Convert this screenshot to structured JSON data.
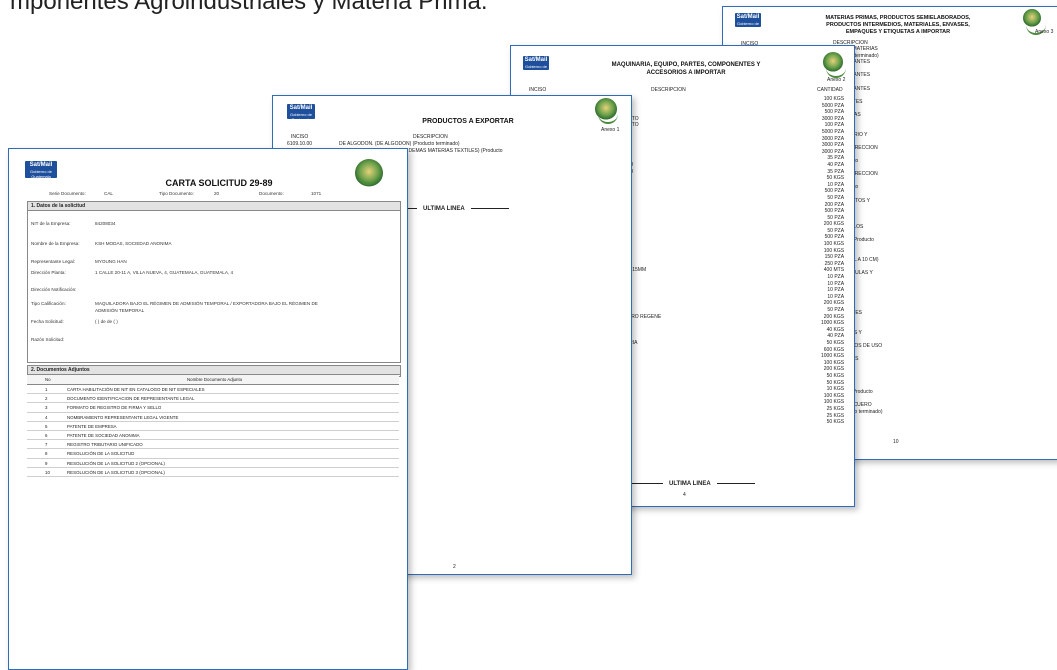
{
  "headline": "mponentes Agroindustriales y Materia Prima.",
  "doc_a3": {
    "title_lines": [
      "MATERIAS PRIMAS, PRODUCTOS SEMIELABORADOS,",
      "PRODUCTOS INTERMEDIOS, MATERIALES, ENVASES,",
      "EMPAQUES Y ETIQUETAS A IMPORTAR"
    ],
    "anexo": "Anexo 3",
    "col_inciso": "INCISO",
    "col_desc": "DESCRIPCION",
    "rows": [
      "ORIGEN VEGETAL O ANIMAL (INCLUIDOS LO, MATERIAS",
      "VEGETAL O ANIMAL (INCLUIDOS LO) (Producto terminado)",
      "PREPARACIONES A BASE DE ESTOS. (COLORANTES",
      "NES A BASE DE ESTOS) (Producto terminado)",
      "PREPARACIONES A BASE DE ESTOS. (COLORANTES",
      "ES A BASE DE ESTOS) (Producto terminado)",
      "PREPARACIONES A BASE DE ESTOS. (COLORANTES",
      "NES A BASE DE ESTOS) (Producto terminado)",
      "IS Y PREPARACIONES A BASE DE. (COLORANTES",
      "CIONES A BASE DE) (Producto terminado)",
      "MEZCLAS DE MATERIAS COLORAN. (LAS DEMAS",
      "MATERIAS COLORAN) (Producto terminado)",
      "roducto terminado)",
      "DRIOS, EN POLVO, GRANULOS. (FRITA DE VIDRIO Y",
      "GRANULOS) (Producto terminado)",
      "ATIVOS EN LAS ARTES GRAFICAS. (PARA CORRECCION",
      "GRAFICAS) (Producto terminado)",
      "ICA. (PARA IMPRESION SERIGRAFICA) (Producto",
      "",
      "ATIVOS EN LAS ARTES GRAFICAS. (PARA CORRECCION",
      "GRAFICAS) (Producto terminado)",
      "ICA. (PARA IMPRESION SERIGRAFICA) (Producto",
      "",
      "ENES ORGANICOS TENSOACTIVOS. (PRODUCTOS Y",
      "TENSOACTIVOS) (Producto terminado)",
      "roducto terminado)",
      "minado)",
      "O EN LA INDUSTRIA TEXTIL O I. (DEL TIPO DE LOS",
      "A TEXTIL O I) (Producto terminado)",
      "ARIAS. (SILICONAS EN FORMAS PRIMARIAS) (Producto",
      "",
      "minado)",
      "UAL A 10 CM. (DE ANCHURA INFERIOR O IGUAL A 10 CM)",
      "",
      "ARTICULOS SIMILARES. (CAJAS, CAJONES, JAULAS Y",
      "ucto terminado)",
      "minado)",
      "O MULTILAMINADAS O EXTRUIDAS. (BOLSAS",
      "AMINADAS O EXTRUIDAS) (Producto terminado)",
      "minado)",
      "EXCEPTO LOS AISLADOS POR VA. (RECIPIENTES",
      "AISLADOS POR VA) (Producto terminado)",
      "minado)",
      "O (ACCESORIOS), DE VESTIR (INCL. (PRENDAS Y",
      "IOS), DE VESTIR (INCL) (Producto terminado)",
      "RAL DEFINIDOS EN LA NOTA 2 DE. (ACCESORIOS DE USO",
      "OTA 2 DE) (Producto terminado)",
      "ALIZADO CON BANO DE ALUMINIO. (ETIQUETAS",
      "ON BANO DE ALUMINIO) (Producto terminado)",
      "",
      "ucto terminado)",
      "ucto terminado)",
      "OLAR). (DE CAUCHO CELULAR (ALVEOLAR)) (Producto",
      "",
      "E DE CUERO O FIBRAS DE CUERO, PLACAS. (CUERO",
      "UERO O FIBRAS DE CUERO, PLACAS) (Producto terminado)",
      "rminado)"
    ],
    "page_number": "10"
  },
  "doc_a2": {
    "title_lines": [
      "MAQUINARIA, EQUIPO, PARTES, COMPONENTES Y",
      "ACCESORIOS A IMPORTAR"
    ],
    "anexo": "Anexo 2",
    "col_inciso": "INCISO",
    "col_desc": "DESCRIPCION",
    "col_qty": "CANTIDAD",
    "rows": [
      {
        "d": "Y COMBUSTIBLES SOLIDOS SIMILARES",
        "q": "100 KGS"
      },
      {
        "d": "VELABLES",
        "q": "5000 PZA"
      },
      {
        "d": "VELABLES",
        "q": "500 PZA"
      },
      {
        "d": "CION FOTOMECANICA (POR EJEMPLO FOTO",
        "q": "3000 PZA"
      },
      {
        "d": "CION FOTOMECANICA (POR EJEMPLO FOTO",
        "q": "100 PZA"
      },
      {
        "d": "",
        "q": "5000 PZA"
      },
      {
        "d": "PAPEL, CARTON Y TEXTILES. FOTOGRA",
        "q": "3000 PZA"
      },
      {
        "d": "CION OFFSET",
        "q": "3000 PZA"
      },
      {
        "d": "",
        "q": "3000 PZA"
      },
      {
        "d": "URO DE VINILO (PVC), DE DIAMETRO EX",
        "q": "35 PZA"
      },
      {
        "d": "URO DE VINILO(PVC) O DE POLICLORURO",
        "q": "40 PZA"
      },
      {
        "d": "URO DE VINILO(PVC) O DE POLICLORURO",
        "q": "35 PZA"
      },
      {
        "d": "",
        "q": "50 KGS"
      },
      {
        "d": "",
        "q": "10 PZA"
      },
      {
        "d": "ETILENO Y ACETATO DE VINILO, DE ES",
        "q": "500 PZA"
      },
      {
        "d": "LOSA",
        "q": "50 PZA"
      },
      {
        "d": "TIRENO",
        "q": "200 PZA"
      },
      {
        "d": "LORURO DE VINILO",
        "q": "500 PZA"
      },
      {
        "d": "",
        "q": "50 PZA"
      },
      {
        "d": "",
        "q": "200 KGS"
      },
      {
        "d": "",
        "q": "50 PZA"
      },
      {
        "d": "",
        "q": "500 PZA"
      },
      {
        "d": "UPTORES O TOMACORRIENTES",
        "q": "100 KGS"
      },
      {
        "d": "TADORAS O DE TRANSMISION",
        "q": "100 KGS"
      },
      {
        "d": "",
        "q": "150 PZA"
      },
      {
        "d": "",
        "q": "250 PZA"
      },
      {
        "d": "OR SUPER O IGUAL A 1.2 MM PERO INF. A 15MM",
        "q": "400 MTS"
      },
      {
        "d": "ENTE CON METAL",
        "q": "10 PZA"
      },
      {
        "d": "ENTE CON MATERIA TEXTIL",
        "q": "10 PZA"
      },
      {
        "d": "ENTE CON PLASTICO",
        "q": "10 PZA"
      },
      {
        "d": "",
        "q": "10 PZA"
      },
      {
        "d": "ADURAS",
        "q": "200 KGS"
      },
      {
        "d": "",
        "q": "50 PZA"
      },
      {
        "d": "O TECNICOS DE CUERO NATURAL O CUERO REGENE",
        "q": "200 KGS"
      },
      {
        "d": "",
        "q": "1000 KGS"
      },
      {
        "d": "",
        "q": "40 KGS"
      },
      {
        "d": "ZADOS PARA EL BOBINADO DE HILA",
        "q": "40 PZA"
      },
      {
        "d": "TADORAS O DE TRANSMISION. DE MATERIA",
        "q": "50 KGS"
      },
      {
        "d": "R A 650 G/M2",
        "q": "600 KGS"
      },
      {
        "d": "OR O IGUAL A 650 G/M2",
        "q": "1000 KGS"
      },
      {
        "d": "RUESAS DEL TIPO DE LOS UTILIZADOS",
        "q": "100 KGS"
      },
      {
        "d": "",
        "q": "200 KGS"
      },
      {
        "d": "E FACIL MECANIZACION",
        "q": "50 KGS"
      },
      {
        "d": "CARBONO INFERIOR AL 0.6% EN PESO",
        "q": "50 KGS"
      },
      {
        "d": "NFERIOR O IGUAL A 1.5 MM PERO INFE",
        "q": "10 KGS"
      },
      {
        "d": "OR O IGUAL A 1.5 MM PERO INFERIOR O",
        "q": "100 KGS"
      },
      {
        "d": "OR O IGUAL A 1.5 MM PERO INFERIOR O",
        "q": "100 KGS"
      },
      {
        "d": "",
        "q": "25 KGS"
      },
      {
        "d": "SIMPLEMENTE LAMINADOS O EXTRUI",
        "q": "25 KGS"
      },
      {
        "d": "",
        "q": "50 KGS"
      }
    ],
    "end_label": "ULTIMA LINEA",
    "page_number": "4"
  },
  "doc_a1": {
    "title": "PRODUCTOS A EXPORTAR",
    "anexo": "Anexo 1",
    "col_inciso": "INCISO",
    "col_desc": "DESCRIPCION",
    "first_code": "6109.10.00",
    "rows": [
      "DE ALGODON. (DE ALGODON) (Producto terminado)",
      "ATERIAS TEXTILES. (DE LAS DEMAS MATERIAS TEXTILES) (Producto",
      "",
      "DON) (Producto terminado)",
      "DON) (Producto terminado)",
      "DON) (Producto terminado)",
      "DON) (Producto terminado)",
      "DON) (Producto terminado)",
      "Producto terminado)",
      "DON) (Producto terminado)",
      "DON) (Producto terminado)"
    ],
    "end_label": "ULTIMA LINEA",
    "page_number": "2"
  },
  "form": {
    "title": "CARTA SOLICITUD 29-89",
    "meta": {
      "serie_label": "Serie Documento:",
      "serie_value": "CAL",
      "tipo_label": "Tipo Documento:",
      "tipo_value": "20",
      "doc_label": "Documento:",
      "doc_value": "1071"
    },
    "section1": "1. Datos de la solicitud",
    "fields": [
      {
        "label": "NIT de la Empresa:",
        "value": "84208034"
      },
      {
        "label": "Nombre de la Empresa:",
        "value": "KSH MODAS, SOCIEDAD ANONIMA"
      },
      {
        "label": "Representante Legal:",
        "value": "MYOUNG HAN"
      },
      {
        "label": "Dirección Planta:",
        "value": "1 CALLE 20-11 A, VILLA NUEVA, 4, GUATEMALA, GUATEMALA, 4"
      },
      {
        "label": "Dirección Notificación:",
        "value": ""
      },
      {
        "label": "Tipo Calificación:",
        "value": "MAQUILADORA BAJO EL RÉGIMEN DE ADMISIÓN TEMPORAL  /  EXPORTADORA BAJO EL RÉGIMEN DE",
        "value2": "ADMISIÓN TEMPORAL"
      },
      {
        "label": "Fecha Solicitud:",
        "value": "( ) de de ( )"
      },
      {
        "label": "Razón Solicitud:",
        "value": ""
      }
    ],
    "section2": "2. Documentos Adjuntos",
    "table_header_no": "No",
    "table_header_name": "Nombre Documento Adjunto",
    "docs": [
      {
        "no": "1",
        "name": "CARTA HABILITACIÓN DE NIT EN CATALOGO DE NIT ESPECIALES"
      },
      {
        "no": "2",
        "name": "DOCUMENTO IDENTIFICACION DE REPRESENTANTE LEGAL"
      },
      {
        "no": "3",
        "name": "FORMATO DE REGISTRO DE FIRMA Y SELLO"
      },
      {
        "no": "4",
        "name": "NOMBRAMIENTO REPRESENTANTE LEGAL VIGENTE"
      },
      {
        "no": "5",
        "name": "PATENTE DE EMPRESA"
      },
      {
        "no": "6",
        "name": "PATENTE DE SOCIEDAD ANONIMA"
      },
      {
        "no": "7",
        "name": "REGISTRO TRIBUTARIO UNIFICADO"
      },
      {
        "no": "8",
        "name": "RESOLUCIÓN DE LA SOLICITUD"
      },
      {
        "no": "9",
        "name": "RESOLUCIÓN DE LA SOLICITUD 2 (OPCIONAL)"
      },
      {
        "no": "10",
        "name": "RESOLUCIÓN DE LA SOLICITUD 3 (OPCIONAL)"
      }
    ]
  },
  "logo": {
    "line1": "Sat/Mail",
    "line2": "Gobierno de Guatemala"
  },
  "colors": {
    "border": "#2f6db8",
    "logo": "#1d4f9c"
  }
}
